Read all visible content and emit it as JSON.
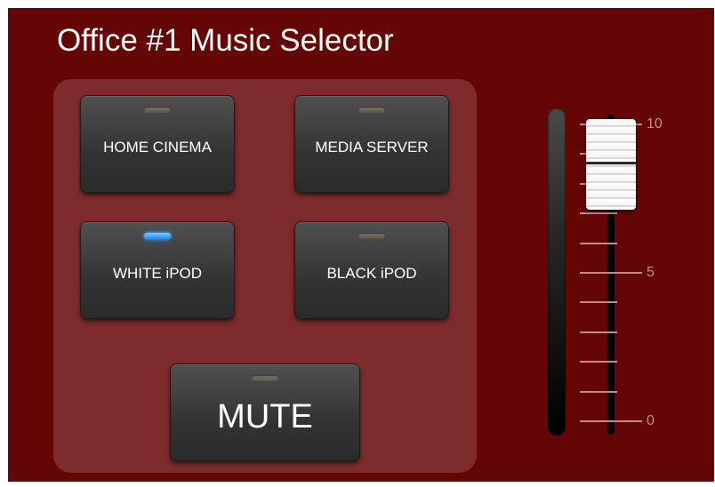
{
  "title": "Office #1 Music Selector",
  "buttons": {
    "home_cinema": "HOME CINEMA",
    "media_server": "MEDIA SERVER",
    "white_ipod": "WHITE iPOD",
    "black_ipod": "BLACK iPOD",
    "mute": "MUTE"
  },
  "active_source": "WHITE iPOD",
  "volume": {
    "max_label": "10",
    "mid_label": "5",
    "min_label": "0",
    "min": 0,
    "max": 10,
    "level": 8.7
  },
  "colors": {
    "background": "#650606",
    "panel": "#7e2b2b",
    "led_active": "#1a8fff",
    "scale": "#c58a8a"
  }
}
